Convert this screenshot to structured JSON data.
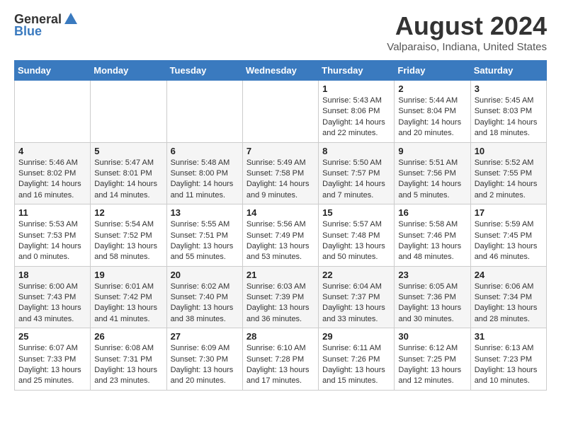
{
  "header": {
    "logo_general": "General",
    "logo_blue": "Blue",
    "title": "August 2024",
    "subtitle": "Valparaiso, Indiana, United States"
  },
  "weekdays": [
    "Sunday",
    "Monday",
    "Tuesday",
    "Wednesday",
    "Thursday",
    "Friday",
    "Saturday"
  ],
  "weeks": [
    [
      {
        "day": "",
        "sunrise": "",
        "sunset": "",
        "daylight": ""
      },
      {
        "day": "",
        "sunrise": "",
        "sunset": "",
        "daylight": ""
      },
      {
        "day": "",
        "sunrise": "",
        "sunset": "",
        "daylight": ""
      },
      {
        "day": "",
        "sunrise": "",
        "sunset": "",
        "daylight": ""
      },
      {
        "day": "1",
        "sunrise": "Sunrise: 5:43 AM",
        "sunset": "Sunset: 8:06 PM",
        "daylight": "Daylight: 14 hours and 22 minutes."
      },
      {
        "day": "2",
        "sunrise": "Sunrise: 5:44 AM",
        "sunset": "Sunset: 8:04 PM",
        "daylight": "Daylight: 14 hours and 20 minutes."
      },
      {
        "day": "3",
        "sunrise": "Sunrise: 5:45 AM",
        "sunset": "Sunset: 8:03 PM",
        "daylight": "Daylight: 14 hours and 18 minutes."
      }
    ],
    [
      {
        "day": "4",
        "sunrise": "Sunrise: 5:46 AM",
        "sunset": "Sunset: 8:02 PM",
        "daylight": "Daylight: 14 hours and 16 minutes."
      },
      {
        "day": "5",
        "sunrise": "Sunrise: 5:47 AM",
        "sunset": "Sunset: 8:01 PM",
        "daylight": "Daylight: 14 hours and 14 minutes."
      },
      {
        "day": "6",
        "sunrise": "Sunrise: 5:48 AM",
        "sunset": "Sunset: 8:00 PM",
        "daylight": "Daylight: 14 hours and 11 minutes."
      },
      {
        "day": "7",
        "sunrise": "Sunrise: 5:49 AM",
        "sunset": "Sunset: 7:58 PM",
        "daylight": "Daylight: 14 hours and 9 minutes."
      },
      {
        "day": "8",
        "sunrise": "Sunrise: 5:50 AM",
        "sunset": "Sunset: 7:57 PM",
        "daylight": "Daylight: 14 hours and 7 minutes."
      },
      {
        "day": "9",
        "sunrise": "Sunrise: 5:51 AM",
        "sunset": "Sunset: 7:56 PM",
        "daylight": "Daylight: 14 hours and 5 minutes."
      },
      {
        "day": "10",
        "sunrise": "Sunrise: 5:52 AM",
        "sunset": "Sunset: 7:55 PM",
        "daylight": "Daylight: 14 hours and 2 minutes."
      }
    ],
    [
      {
        "day": "11",
        "sunrise": "Sunrise: 5:53 AM",
        "sunset": "Sunset: 7:53 PM",
        "daylight": "Daylight: 14 hours and 0 minutes."
      },
      {
        "day": "12",
        "sunrise": "Sunrise: 5:54 AM",
        "sunset": "Sunset: 7:52 PM",
        "daylight": "Daylight: 13 hours and 58 minutes."
      },
      {
        "day": "13",
        "sunrise": "Sunrise: 5:55 AM",
        "sunset": "Sunset: 7:51 PM",
        "daylight": "Daylight: 13 hours and 55 minutes."
      },
      {
        "day": "14",
        "sunrise": "Sunrise: 5:56 AM",
        "sunset": "Sunset: 7:49 PM",
        "daylight": "Daylight: 13 hours and 53 minutes."
      },
      {
        "day": "15",
        "sunrise": "Sunrise: 5:57 AM",
        "sunset": "Sunset: 7:48 PM",
        "daylight": "Daylight: 13 hours and 50 minutes."
      },
      {
        "day": "16",
        "sunrise": "Sunrise: 5:58 AM",
        "sunset": "Sunset: 7:46 PM",
        "daylight": "Daylight: 13 hours and 48 minutes."
      },
      {
        "day": "17",
        "sunrise": "Sunrise: 5:59 AM",
        "sunset": "Sunset: 7:45 PM",
        "daylight": "Daylight: 13 hours and 46 minutes."
      }
    ],
    [
      {
        "day": "18",
        "sunrise": "Sunrise: 6:00 AM",
        "sunset": "Sunset: 7:43 PM",
        "daylight": "Daylight: 13 hours and 43 minutes."
      },
      {
        "day": "19",
        "sunrise": "Sunrise: 6:01 AM",
        "sunset": "Sunset: 7:42 PM",
        "daylight": "Daylight: 13 hours and 41 minutes."
      },
      {
        "day": "20",
        "sunrise": "Sunrise: 6:02 AM",
        "sunset": "Sunset: 7:40 PM",
        "daylight": "Daylight: 13 hours and 38 minutes."
      },
      {
        "day": "21",
        "sunrise": "Sunrise: 6:03 AM",
        "sunset": "Sunset: 7:39 PM",
        "daylight": "Daylight: 13 hours and 36 minutes."
      },
      {
        "day": "22",
        "sunrise": "Sunrise: 6:04 AM",
        "sunset": "Sunset: 7:37 PM",
        "daylight": "Daylight: 13 hours and 33 minutes."
      },
      {
        "day": "23",
        "sunrise": "Sunrise: 6:05 AM",
        "sunset": "Sunset: 7:36 PM",
        "daylight": "Daylight: 13 hours and 30 minutes."
      },
      {
        "day": "24",
        "sunrise": "Sunrise: 6:06 AM",
        "sunset": "Sunset: 7:34 PM",
        "daylight": "Daylight: 13 hours and 28 minutes."
      }
    ],
    [
      {
        "day": "25",
        "sunrise": "Sunrise: 6:07 AM",
        "sunset": "Sunset: 7:33 PM",
        "daylight": "Daylight: 13 hours and 25 minutes."
      },
      {
        "day": "26",
        "sunrise": "Sunrise: 6:08 AM",
        "sunset": "Sunset: 7:31 PM",
        "daylight": "Daylight: 13 hours and 23 minutes."
      },
      {
        "day": "27",
        "sunrise": "Sunrise: 6:09 AM",
        "sunset": "Sunset: 7:30 PM",
        "daylight": "Daylight: 13 hours and 20 minutes."
      },
      {
        "day": "28",
        "sunrise": "Sunrise: 6:10 AM",
        "sunset": "Sunset: 7:28 PM",
        "daylight": "Daylight: 13 hours and 17 minutes."
      },
      {
        "day": "29",
        "sunrise": "Sunrise: 6:11 AM",
        "sunset": "Sunset: 7:26 PM",
        "daylight": "Daylight: 13 hours and 15 minutes."
      },
      {
        "day": "30",
        "sunrise": "Sunrise: 6:12 AM",
        "sunset": "Sunset: 7:25 PM",
        "daylight": "Daylight: 13 hours and 12 minutes."
      },
      {
        "day": "31",
        "sunrise": "Sunrise: 6:13 AM",
        "sunset": "Sunset: 7:23 PM",
        "daylight": "Daylight: 13 hours and 10 minutes."
      }
    ]
  ]
}
